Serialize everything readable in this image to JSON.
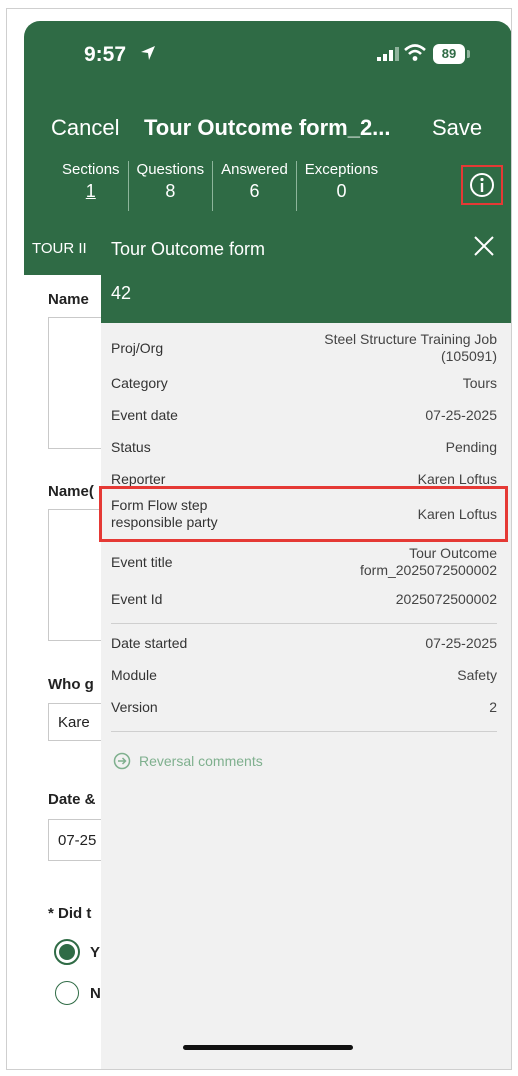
{
  "status_bar": {
    "time": "9:57",
    "battery": "89"
  },
  "header": {
    "cancel": "Cancel",
    "title": "Tour Outcome form_2...",
    "save": "Save",
    "stats": [
      {
        "label": "Sections",
        "value": "1"
      },
      {
        "label": "Questions",
        "value": "8"
      },
      {
        "label": "Answered",
        "value": "6"
      },
      {
        "label": "Exceptions",
        "value": "0"
      }
    ]
  },
  "background_form": {
    "section_title": "TOUR II",
    "name_label": "Name",
    "name2_label": "Name(",
    "who_label": "Who g",
    "who_value": "Kare",
    "date_label": "Date &",
    "date_value": "07-25",
    "did_label": "* Did t",
    "radio_yes": "Y",
    "radio_no": "N"
  },
  "info_panel": {
    "title": "Tour Outcome form",
    "id": "42",
    "rows": [
      {
        "key": "Proj/Org",
        "value": "Steel Structure Training Job (105091)"
      },
      {
        "key": "Category",
        "value": "Tours"
      },
      {
        "key": "Event date",
        "value": "07-25-2025"
      },
      {
        "key": "Status",
        "value": "Pending"
      },
      {
        "key": "Reporter",
        "value": "Karen Loftus"
      },
      {
        "key": "Form Flow step responsible party",
        "value": "Karen Loftus"
      },
      {
        "key": "Event title",
        "value": "Tour Outcome form_2025072500002"
      },
      {
        "key": "Event Id",
        "value": "2025072500002"
      },
      {
        "key": "Date started",
        "value": "07-25-2025"
      },
      {
        "key": "Module",
        "value": "Safety"
      },
      {
        "key": "Version",
        "value": "2"
      }
    ],
    "reversal_label": "Reversal comments"
  },
  "colors": {
    "brand_green": "#2f6b45",
    "highlight_red": "#e53935",
    "muted_green": "#7fb08e"
  }
}
